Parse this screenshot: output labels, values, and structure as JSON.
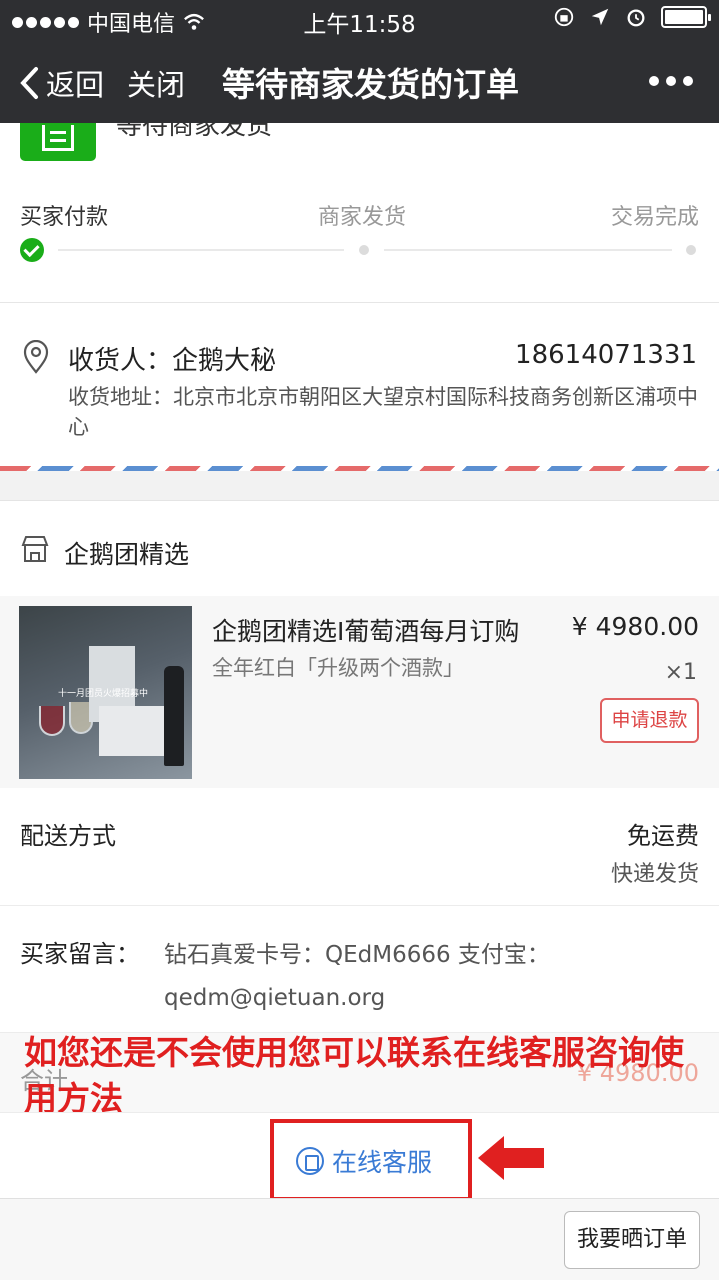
{
  "status_bar": {
    "carrier": "中国电信",
    "time": "上午11:58"
  },
  "nav": {
    "back_label": "返回",
    "close_label": "关闭",
    "title": "等待商家发货的订单"
  },
  "order_status": {
    "text": "等待商家发货",
    "steps": [
      "买家付款",
      "商家发货",
      "交易完成"
    ]
  },
  "address": {
    "recipient": "收货人：企鹅大秘",
    "phone": "18614071331",
    "detail": "收货地址：北京市北京市朝阳区大望京村国际科技商务创新区浦项中心"
  },
  "shop": {
    "name": "企鹅团精选"
  },
  "product": {
    "title": "企鹅团精选I葡萄酒每月订购",
    "price": "¥ 4980.00",
    "spec": "全年红白「升级两个酒款」",
    "quantity": "×1",
    "refund_label": "申请退款",
    "image_caption": "十一月团员火爆招募中"
  },
  "delivery": {
    "label": "配送方式",
    "fee": "免运费",
    "method": "快递发货"
  },
  "message": {
    "label": "买家留言：",
    "text": "钻石真爱卡号：QEdM6666 支付宝：qedm@qietuan.org"
  },
  "total": {
    "label": "合计",
    "value": "¥ 4980.00"
  },
  "annotation": {
    "text": "如您还是不会使用您可以联系在线客服咨询使用方法",
    "color": "#e02020"
  },
  "service": {
    "label": "在线客服",
    "icon": "chat-icon"
  },
  "bottom": {
    "show_order_label": "我要晒订单"
  },
  "colors": {
    "nav_bg": "#2e2f32",
    "accent_green": "#1aad19",
    "link_blue": "#3a7bd5",
    "refund_red": "#d44"
  }
}
